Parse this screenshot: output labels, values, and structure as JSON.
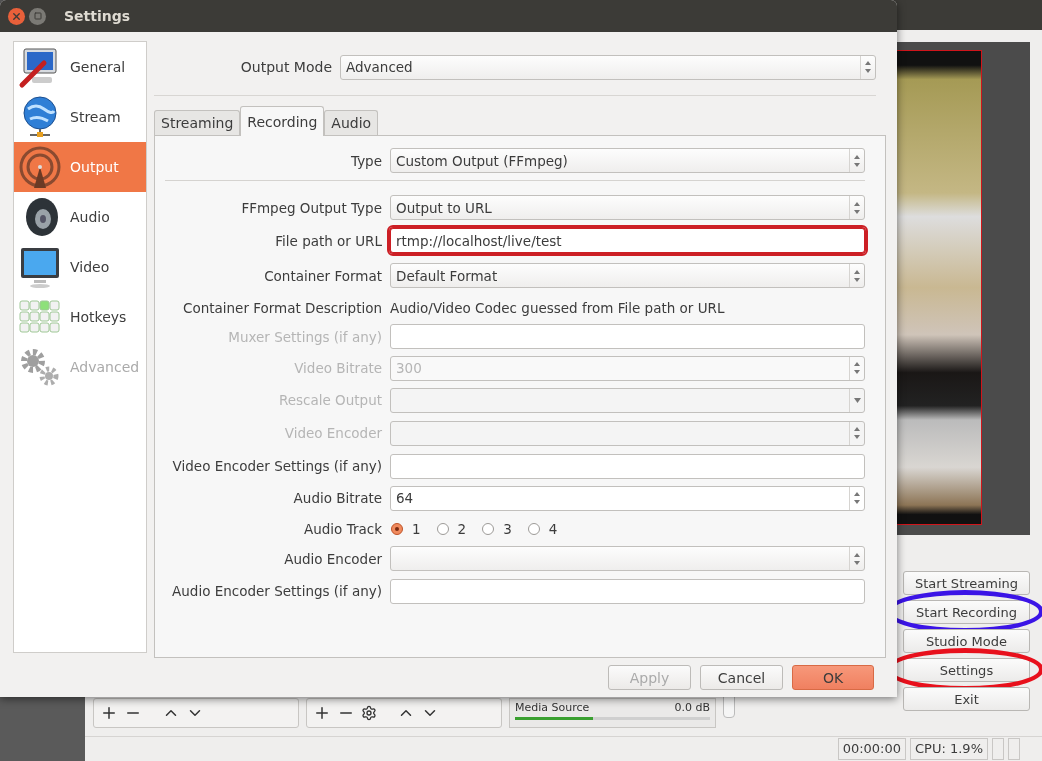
{
  "dialog": {
    "title": "Settings",
    "sidebar": {
      "items": [
        {
          "label": "General",
          "kind": "general",
          "selected": false,
          "disabled": false
        },
        {
          "label": "Stream",
          "kind": "stream",
          "selected": false,
          "disabled": false
        },
        {
          "label": "Output",
          "kind": "output",
          "selected": true,
          "disabled": false
        },
        {
          "label": "Audio",
          "kind": "audio",
          "selected": false,
          "disabled": false
        },
        {
          "label": "Video",
          "kind": "video",
          "selected": false,
          "disabled": false
        },
        {
          "label": "Hotkeys",
          "kind": "hotkeys",
          "selected": false,
          "disabled": false
        },
        {
          "label": "Advanced",
          "kind": "advanced",
          "selected": false,
          "disabled": true
        }
      ]
    },
    "output_mode": {
      "label": "Output Mode",
      "value": "Advanced"
    },
    "tabs": [
      {
        "label": "Streaming",
        "selected": false
      },
      {
        "label": "Recording",
        "selected": true
      },
      {
        "label": "Audio",
        "selected": false
      }
    ],
    "type": {
      "label": "Type",
      "value": "Custom Output (FFmpeg)"
    },
    "rows": [
      {
        "label": "FFmpeg Output Type",
        "kind": "select",
        "value": "Output to URL",
        "disabled": false,
        "highlighted": false
      },
      {
        "label": "File path or URL",
        "kind": "input",
        "value": "rtmp://localhost/live/test",
        "disabled": false,
        "highlighted": true
      },
      {
        "label": "Container Format",
        "kind": "select",
        "value": "Default Format",
        "disabled": false,
        "highlighted": false
      },
      {
        "label": "Container Format Description",
        "kind": "text",
        "value": "Audio/Video Codec guessed from File path or URL",
        "disabled": false,
        "highlighted": false
      },
      {
        "label": "Muxer Settings (if any)",
        "kind": "input",
        "disabled": true,
        "highlighted": false
      },
      {
        "label": "Video Bitrate",
        "kind": "spin",
        "value": "300",
        "disabled": true,
        "highlighted": false
      },
      {
        "label": "Rescale Output",
        "kind": "combo",
        "disabled": true,
        "highlighted": false
      },
      {
        "label": "Video Encoder",
        "kind": "select",
        "disabled": true,
        "highlighted": false
      },
      {
        "label": "Video Encoder Settings (if any)",
        "kind": "input",
        "disabled": false,
        "highlighted": false
      },
      {
        "label": "Audio Bitrate",
        "kind": "spin",
        "value": "64",
        "disabled": false,
        "highlighted": false
      },
      {
        "label": "Audio Track",
        "kind": "radio",
        "disabled": false,
        "highlighted": false,
        "options": [
          {
            "label": "1",
            "selected": true
          },
          {
            "label": "2",
            "selected": false
          },
          {
            "label": "3",
            "selected": false
          },
          {
            "label": "4",
            "selected": false
          }
        ]
      },
      {
        "label": "Audio Encoder",
        "kind": "select",
        "disabled": false,
        "highlighted": false
      },
      {
        "label": "Audio Encoder Settings (if any)",
        "kind": "input",
        "disabled": false,
        "highlighted": false
      }
    ],
    "buttons": [
      {
        "label": "Apply",
        "kind": "plain",
        "disabled": true
      },
      {
        "label": "Cancel",
        "kind": "plain",
        "disabled": false
      },
      {
        "label": "OK",
        "kind": "primary",
        "disabled": false
      }
    ]
  },
  "main_window": {
    "controls": [
      {
        "label": "Start Streaming",
        "circled": false
      },
      {
        "label": "Start Recording",
        "circled": true,
        "color": "#3b14e6"
      },
      {
        "label": "Studio Mode",
        "circled": false
      },
      {
        "label": "Settings",
        "circled": true,
        "color": "#e8101c"
      },
      {
        "label": "Exit",
        "circled": false
      }
    ],
    "mixer": {
      "source": "Media Source",
      "reading": "0.0 dB",
      "level": 0.4
    },
    "status_bar": {
      "time": "00:00:00",
      "cpu": "CPU: 1.9%"
    }
  }
}
